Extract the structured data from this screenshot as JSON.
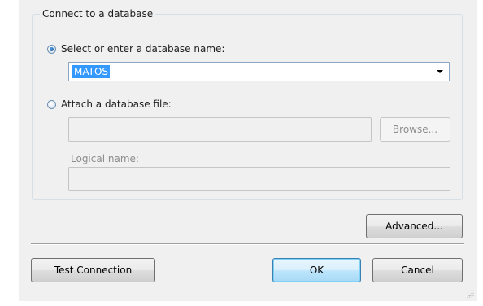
{
  "group": {
    "title": "Connect to a database"
  },
  "options": {
    "select_db_label": "Select or enter a database name:",
    "attach_file_label": "Attach a database file:"
  },
  "database_combo": {
    "value": "MATOS"
  },
  "attach": {
    "file_path_value": "",
    "browse_label": "Browse...",
    "logical_name_label": "Logical name:",
    "logical_name_value": ""
  },
  "buttons": {
    "advanced_label": "Advanced...",
    "test_connection_label": "Test Connection",
    "ok_label": "OK",
    "cancel_label": "Cancel"
  },
  "colors": {
    "selection": "#3399ff",
    "dialog_background": "#f0f0f0",
    "default_button_border": "#3c7fb1"
  }
}
